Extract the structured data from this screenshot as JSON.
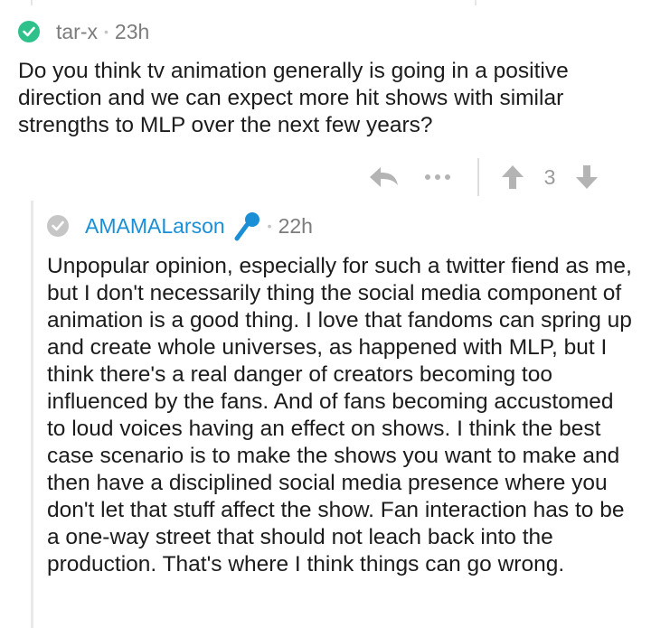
{
  "parent_comment": {
    "username": "tar-x",
    "separator": "•",
    "age": "23h",
    "body": "Do you think tv animation generally is going in a positive direction and we can expect more hit shows with similar strengths to MLP over the next few years?",
    "verified_icon": "check-circle-icon",
    "actions": {
      "reply_icon": "reply-arrow-icon",
      "more_icon": "more-dots-icon",
      "upvote_icon": "upvote-arrow-icon",
      "score": "3",
      "downvote_icon": "downvote-arrow-icon"
    }
  },
  "reply_comment": {
    "username": "AMAMALarson",
    "separator": "•",
    "age": "22h",
    "badge_icon": "microphone-icon",
    "status_icon": "check-circle-icon",
    "body": "Unpopular opinion, especially for such a twitter fiend as me, but I don't necessarily thing the social media component of animation is a good thing. I love that fandoms can spring up and create whole universes, as happened with MLP, but I think there's a real danger of creators becoming too influenced by the fans. And of fans becoming accustomed to loud voices having an effect on shows. I think the best case scenario is to make the shows you want to make and then have a disciplined social media presence where you don't let that stuff affect the show. Fan interaction has to be a one-way street that should not leach back into the production. That's where I think things can go wrong."
  },
  "colors": {
    "text": "#1c1c1c",
    "meta": "#7c7c7c",
    "username_link": "#1a8fd6",
    "verified_green": "#2fc18c",
    "icon_grey": "#c6c6c6",
    "action_grey": "#b4b4b4"
  }
}
